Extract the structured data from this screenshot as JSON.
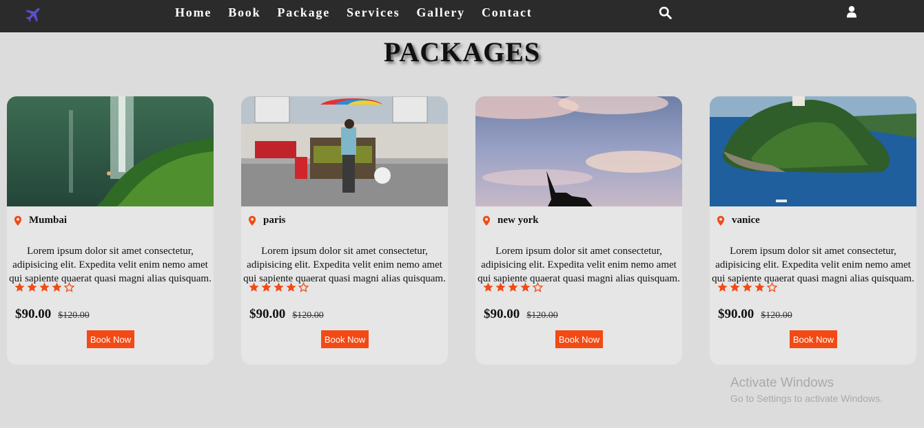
{
  "nav": {
    "logo_icon": "airplane-icon",
    "links": [
      "Home",
      "Book",
      "Package",
      "Services",
      "Gallery",
      "Contact"
    ],
    "search_icon": "search-icon",
    "user_icon": "user-icon"
  },
  "page": {
    "title": "PACKAGES"
  },
  "packages": [
    {
      "location": "Mumbai",
      "description": "Lorem ipsum dolor sit amet consectetur, adipisicing elit. Expedita velit enim nemo amet qui sapiente quaerat quasi magni alias quisquam.",
      "rating": 4,
      "rating_max": 5,
      "price": "$90.00",
      "old_price": "$120.00",
      "button": "Book Now"
    },
    {
      "location": "paris",
      "description": "Lorem ipsum dolor sit amet consectetur, adipisicing elit. Expedita velit enim nemo amet qui sapiente quaerat quasi magni alias quisquam.",
      "rating": 4,
      "rating_max": 5,
      "price": "$90.00",
      "old_price": "$120.00",
      "button": "Book Now"
    },
    {
      "location": "new york",
      "description": "Lorem ipsum dolor sit amet consectetur, adipisicing elit. Expedita velit enim nemo amet qui sapiente quaerat quasi magni alias quisquam.",
      "rating": 4,
      "rating_max": 5,
      "price": "$90.00",
      "old_price": "$120.00",
      "button": "Book Now"
    },
    {
      "location": "vanice",
      "description": "Lorem ipsum dolor sit amet consectetur, adipisicing elit. Expedita velit enim nemo amet qui sapiente quaerat quasi magni alias quisquam.",
      "rating": 4,
      "rating_max": 5,
      "price": "$90.00",
      "old_price": "$120.00",
      "button": "Book Now"
    }
  ],
  "watermark": {
    "title": "Activate Windows",
    "subtitle": "Go to Settings to activate Windows."
  },
  "colors": {
    "navbar": "#2b2b2b",
    "accent": "#f24a14",
    "logo": "#5a4fcf",
    "background": "#dcdcdc",
    "card": "#e6e6e6"
  }
}
